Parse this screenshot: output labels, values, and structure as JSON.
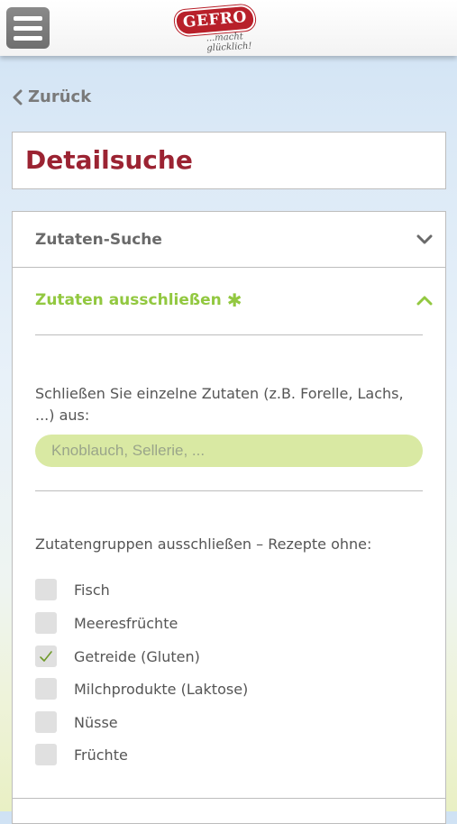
{
  "header": {
    "menu_icon": "hamburger-menu-icon",
    "logo_brand": "GEFRO",
    "logo_tagline": "...macht glücklich!"
  },
  "nav": {
    "back_label": "Zurück",
    "back_icon": "chevron-left-icon"
  },
  "page": {
    "title": "Detailsuche"
  },
  "accordion": {
    "section1": {
      "label": "Zutaten-Suche",
      "state": "collapsed",
      "icon": "chevron-down-icon"
    },
    "section2": {
      "label": "Zutaten ausschließen",
      "marker": "✱",
      "state": "expanded",
      "icon": "chevron-up-icon",
      "accent": "#92c840"
    }
  },
  "exclude": {
    "description": "Schließen Sie einzelne Zutaten (z.B. Forelle, Lachs, ...) aus:",
    "input_value": "",
    "input_placeholder": "Knoblauch, Sellerie, ...",
    "groups_label": "Zutatengruppen ausschließen – Rezepte ohne:",
    "groups": [
      {
        "label": "Fisch",
        "checked": false
      },
      {
        "label": "Meeresfrüchte",
        "checked": false
      },
      {
        "label": "Getreide (Gluten)",
        "checked": true
      },
      {
        "label": "Milchprodukte (Laktose)",
        "checked": false
      },
      {
        "label": "Nüsse",
        "checked": false
      },
      {
        "label": "Früchte",
        "checked": false
      }
    ]
  },
  "colors": {
    "title": "#9b2332",
    "accent_green": "#92c840",
    "input_bg": "#d9e9a3",
    "brand_red": "#b8202a"
  }
}
